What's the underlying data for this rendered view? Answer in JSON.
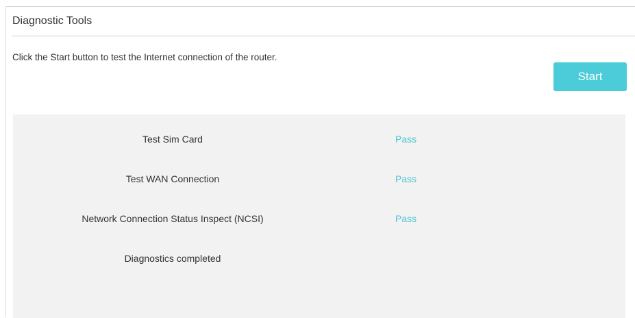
{
  "diagnostic": {
    "title": "Diagnostic Tools",
    "instruction": "Click the Start button to test the Internet connection of the router.",
    "start_label": "Start",
    "results": [
      {
        "name": "Test Sim Card",
        "status": "Pass"
      },
      {
        "name": "Test WAN Connection",
        "status": "Pass"
      },
      {
        "name": "Network Connection Status Inspect (NCSI)",
        "status": "Pass"
      },
      {
        "name": "Diagnostics completed",
        "status": ""
      }
    ]
  },
  "colors": {
    "accent": "#4ccbd8",
    "pass": "#4cc4d2",
    "panel_bg": "#f2f2f2"
  }
}
